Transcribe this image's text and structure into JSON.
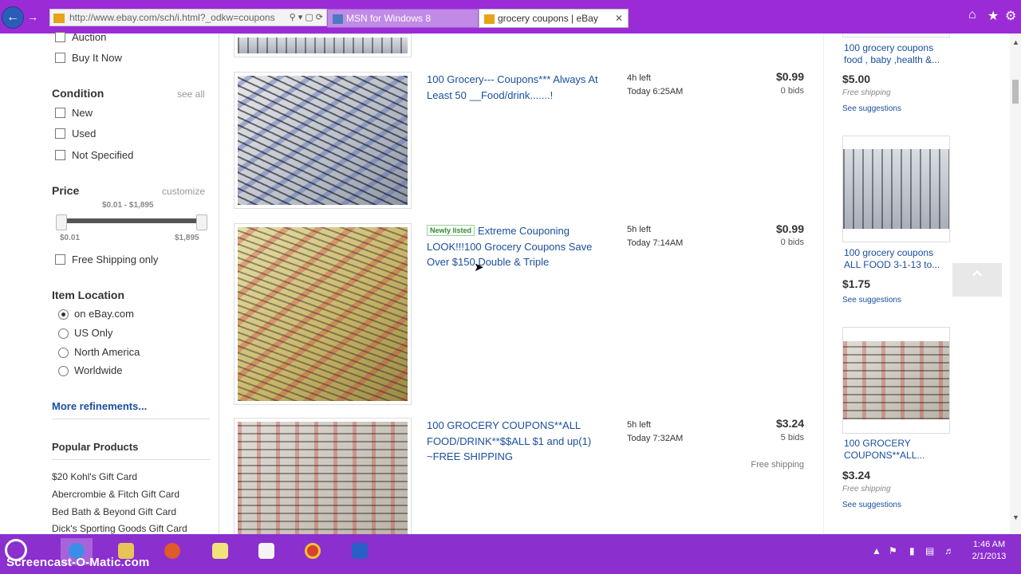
{
  "browser": {
    "back_icon": "back-arrow-icon",
    "address_url": "http://www.ebay.com/sch/i.html?_odkw=coupons",
    "tabs": [
      {
        "title": "MSN for Windows 8"
      },
      {
        "title": "grocery coupons | eBay"
      }
    ]
  },
  "sidebar": {
    "format_options": [
      "Auction",
      "Buy It Now"
    ],
    "condition": {
      "heading": "Condition",
      "link": "see all",
      "options": [
        "New",
        "Used",
        "Not Specified"
      ]
    },
    "price": {
      "heading": "Price",
      "link": "customize",
      "range_label": "$0.01 - $1,895",
      "min": "$0.01",
      "max": "$1,895",
      "free_shipping": "Free Shipping only"
    },
    "location": {
      "heading": "Item Location",
      "options": [
        "on eBay.com",
        "US Only",
        "North America",
        "Worldwide"
      ],
      "selected": "on eBay.com"
    },
    "more_refinements": "More refinements...",
    "popular": {
      "heading": "Popular Products",
      "items": [
        "$20 Kohl's Gift Card",
        "Abercrombie & Fitch Gift Card",
        "Bed Bath & Beyond Gift Card",
        "Dick's Sporting Goods Gift Card"
      ]
    }
  },
  "listings": [
    {
      "title": "100 Grocery--- Coupons*** Always At Least 50 __Food/drink.......!",
      "badge": "",
      "time_left": "4h left",
      "end_time": "Today 6:25AM",
      "price": "$0.99",
      "bids": "0 bids",
      "shipping": ""
    },
    {
      "title": "Extreme Couponing LOOK!!!100 Grocery Coupons Save Over $150 Double & Triple",
      "badge": "Newly listed",
      "time_left": "5h left",
      "end_time": "Today 7:14AM",
      "price": "$0.99",
      "bids": "0 bids",
      "shipping": ""
    },
    {
      "title": "100 GROCERY COUPONS**ALL FOOD/DRINK**$$ALL $1 and up(1) ~FREE SHIPPING",
      "badge": "",
      "time_left": "5h left",
      "end_time": "Today 7:32AM",
      "price": "$3.24",
      "bids": "5 bids",
      "shipping": "Free shipping"
    }
  ],
  "suggestions": [
    {
      "title": "100 grocery coupons food , baby ,health &...",
      "price": "$5.00",
      "shipping": "Free shipping",
      "link": "See suggestions"
    },
    {
      "title": "100 grocery coupons ALL FOOD 3-1-13 to...",
      "price": "$1.75",
      "shipping": "",
      "link": "See suggestions"
    },
    {
      "title": "100 GROCERY COUPONS**ALL...",
      "price": "$3.24",
      "shipping": "Free shipping",
      "link": "See suggestions"
    }
  ],
  "taskbar": {
    "watermark": "Screencast-O-Matic.com",
    "time": "1:46 AM",
    "date": "2/1/2013"
  },
  "colors": {
    "window_accent": "#9b2bd6",
    "taskbar": "#8b2fcf",
    "link": "#1a4fa0"
  }
}
